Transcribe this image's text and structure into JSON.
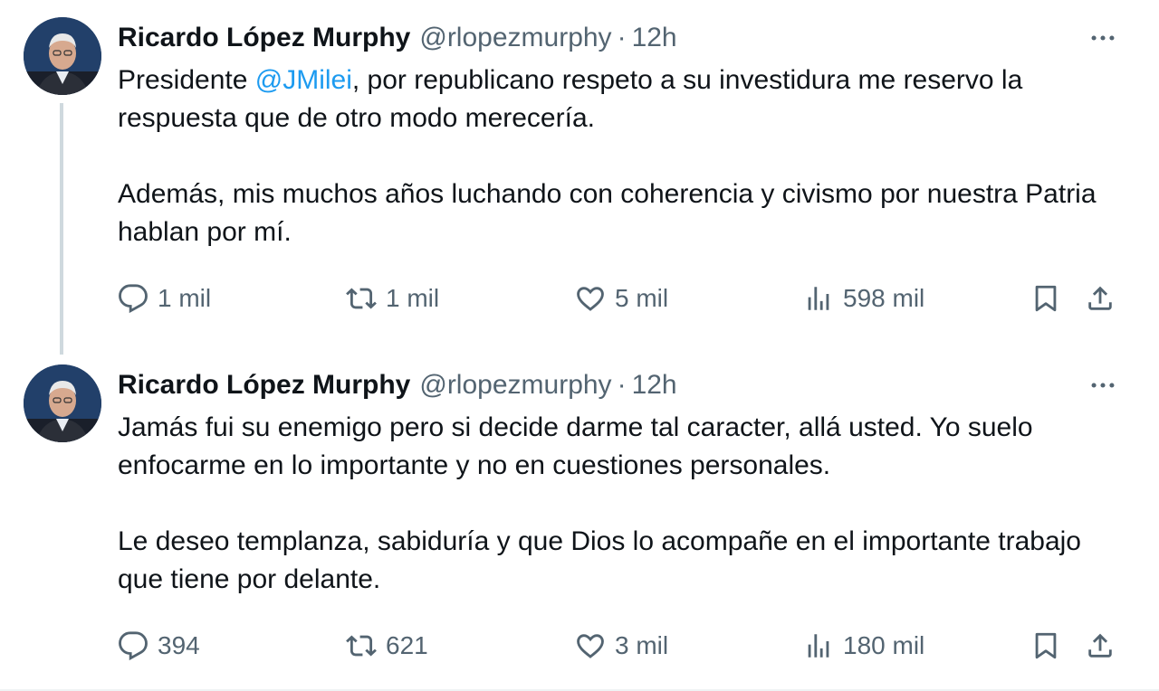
{
  "tweets": [
    {
      "author": {
        "name": "Ricardo López Murphy",
        "handle": "@rlopezmurphy",
        "time": "12h"
      },
      "text": {
        "p1_before": "Presidente ",
        "p1_mention": "@JMilei",
        "p1_after": ", por republicano respeto a su investidura me reservo la respuesta que de otro modo merecería.",
        "p2": "Además, mis muchos años luchando con coherencia y civismo por nuestra Patria hablan por mí."
      },
      "stats": {
        "replies": "1 mil",
        "retweets": "1 mil",
        "likes": "5 mil",
        "views": "598 mil"
      }
    },
    {
      "author": {
        "name": "Ricardo López Murphy",
        "handle": "@rlopezmurphy",
        "time": "12h"
      },
      "text": {
        "p1": "Jamás fui su enemigo pero si decide darme tal caracter, allá usted. Yo suelo enfocarme en lo importante y no en cuestiones personales.",
        "p2": "Le deseo templanza, sabiduría y que Dios lo acompañe en el importante trabajo que tiene por delante."
      },
      "stats": {
        "replies": "394",
        "retweets": "621",
        "likes": "3 mil",
        "views": "180 mil"
      }
    }
  ],
  "ui": {
    "separator": "·"
  },
  "colors": {
    "text": "#0f1419",
    "secondary": "#536471",
    "link": "#1d9bf0",
    "thread_line": "#cfd9de"
  },
  "icons": [
    "reply-icon",
    "retweet-icon",
    "like-icon",
    "views-icon",
    "bookmark-icon",
    "share-icon",
    "more-icon"
  ]
}
